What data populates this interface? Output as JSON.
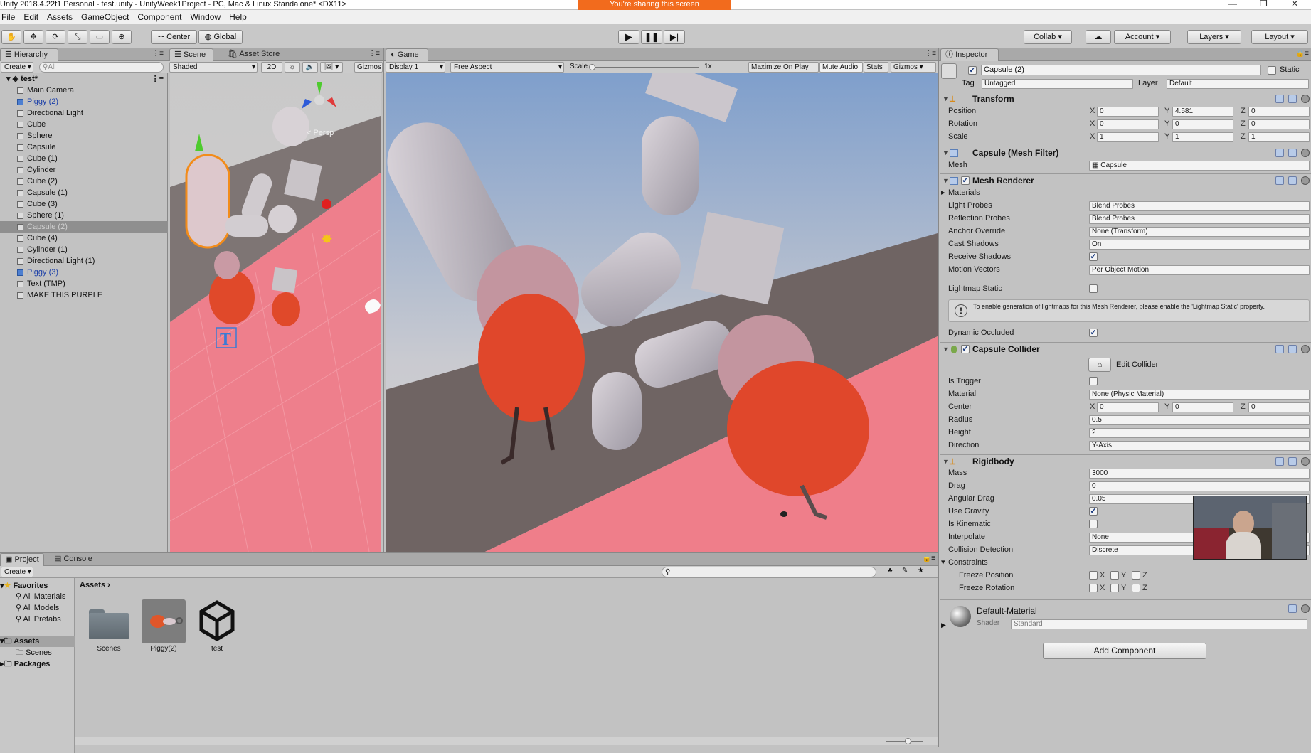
{
  "window": {
    "title": "Unity 2018.4.22f1 Personal - test.unity - UnityWeek1Project - PC, Mac & Linux Standalone* <DX11>",
    "share_banner": "You're sharing this screen"
  },
  "menu": [
    "File",
    "Edit",
    "Assets",
    "GameObject",
    "Component",
    "Window",
    "Help"
  ],
  "toolbar": {
    "center": "Center",
    "global": "Global",
    "collab": "Collab",
    "account": "Account",
    "layers": "Layers",
    "layout": "Layout"
  },
  "hierarchy": {
    "tab": "Hierarchy",
    "create": "Create",
    "search_placeholder": "All",
    "scene": "test*",
    "items": [
      {
        "label": "Main Camera",
        "style": "normal"
      },
      {
        "label": "Piggy (2)",
        "style": "blue"
      },
      {
        "label": "Directional Light",
        "style": "normal"
      },
      {
        "label": "Cube",
        "style": "normal"
      },
      {
        "label": "Sphere",
        "style": "normal"
      },
      {
        "label": "Capsule",
        "style": "normal"
      },
      {
        "label": "Cube (1)",
        "style": "normal"
      },
      {
        "label": "Cylinder",
        "style": "normal"
      },
      {
        "label": "Cube (2)",
        "style": "normal"
      },
      {
        "label": "Capsule (1)",
        "style": "normal"
      },
      {
        "label": "Cube (3)",
        "style": "normal"
      },
      {
        "label": "Sphere (1)",
        "style": "normal"
      },
      {
        "label": "Capsule (2)",
        "style": "sel"
      },
      {
        "label": "Cube (4)",
        "style": "normal"
      },
      {
        "label": "Cylinder (1)",
        "style": "normal"
      },
      {
        "label": "Directional Light (1)",
        "style": "normal"
      },
      {
        "label": "Piggy (3)",
        "style": "blue"
      },
      {
        "label": "Text (TMP)",
        "style": "normal"
      },
      {
        "label": "MAKE THIS PURPLE",
        "style": "normal"
      }
    ]
  },
  "scene": {
    "tab": "Scene",
    "asset_store": "Asset Store",
    "shaded": "Shaded",
    "mode2d": "2D",
    "gizmos": "Gizmos",
    "persp": "< Persp"
  },
  "game": {
    "tab": "Game",
    "display": "Display 1",
    "aspect": "Free Aspect",
    "scale_label": "Scale",
    "scale_value": "1x",
    "maximize": "Maximize On Play",
    "mute": "Mute Audio",
    "stats": "Stats",
    "gizmos": "Gizmos"
  },
  "inspector": {
    "tab": "Inspector",
    "object_name": "Capsule (2)",
    "static": "Static",
    "tag_label": "Tag",
    "tag": "Untagged",
    "layer_label": "Layer",
    "layer": "Default",
    "transform": {
      "title": "Transform",
      "position_label": "Position",
      "rotation_label": "Rotation",
      "scale_label": "Scale",
      "position": [
        "0",
        "4.581",
        "0"
      ],
      "rotation": [
        "0",
        "0",
        "0"
      ],
      "scale": [
        "1",
        "1",
        "1"
      ]
    },
    "mesh_filter": {
      "title": "Capsule (Mesh Filter)",
      "mesh_label": "Mesh",
      "mesh": "Capsule"
    },
    "mesh_renderer": {
      "title": "Mesh Renderer",
      "materials": "Materials",
      "light_probes_label": "Light Probes",
      "light_probes": "Blend Probes",
      "reflection_label": "Reflection Probes",
      "reflection": "Blend Probes",
      "anchor_label": "Anchor Override",
      "anchor": "None (Transform)",
      "cast_label": "Cast Shadows",
      "cast": "On",
      "receive_label": "Receive Shadows",
      "motion_label": "Motion Vectors",
      "motion": "Per Object Motion",
      "lightmap_label": "Lightmap Static",
      "info": "To enable generation of lightmaps for this Mesh Renderer, please enable the 'Lightmap Static' property.",
      "dynamic_label": "Dynamic Occluded"
    },
    "capsule_collider": {
      "title": "Capsule Collider",
      "edit": "Edit Collider",
      "trigger_label": "Is Trigger",
      "material_label": "Material",
      "material": "None (Physic Material)",
      "center_label": "Center",
      "center": [
        "0",
        "0",
        "0"
      ],
      "radius_label": "Radius",
      "radius": "0.5",
      "height_label": "Height",
      "height": "2",
      "direction_label": "Direction",
      "direction": "Y-Axis"
    },
    "rigidbody": {
      "title": "Rigidbody",
      "mass_label": "Mass",
      "mass": "3000",
      "drag_label": "Drag",
      "drag": "0",
      "angular_label": "Angular Drag",
      "angular": "0.05",
      "gravity_label": "Use Gravity",
      "kinematic_label": "Is Kinematic",
      "interpolate_label": "Interpolate",
      "interpolate": "None",
      "collision_label": "Collision Detection",
      "collision": "Discrete",
      "constraints_label": "Constraints",
      "freeze_pos_label": "Freeze Position",
      "freeze_rot_label": "Freeze Rotation"
    },
    "material": {
      "name": "Default-Material",
      "shader_label": "Shader",
      "shader": "Standard"
    },
    "add_component": "Add Component"
  },
  "project": {
    "tab": "Project",
    "console_tab": "Console",
    "create": "Create",
    "favorites": "Favorites",
    "fav_items": [
      "All Materials",
      "All Models",
      "All Prefabs"
    ],
    "assets_root": "Assets",
    "assets_children": [
      "Scenes"
    ],
    "packages": "Packages",
    "breadcrumb": "Assets",
    "assets": [
      {
        "name": "Scenes"
      },
      {
        "name": "Piggy(2)"
      },
      {
        "name": "test"
      }
    ]
  },
  "axes": {
    "x": "X",
    "y": "Y",
    "z": "Z"
  }
}
